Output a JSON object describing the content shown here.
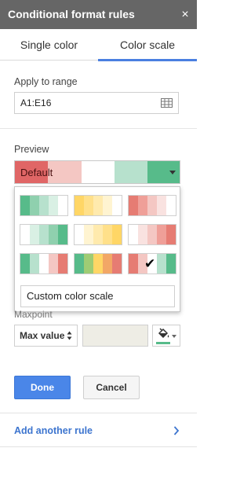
{
  "header": {
    "title": "Conditional format rules",
    "close_glyph": "×"
  },
  "tabs": [
    {
      "label": "Single color",
      "selected": false
    },
    {
      "label": "Color scale",
      "selected": true
    }
  ],
  "range": {
    "label": "Apply to range",
    "value": "A1:E16"
  },
  "preview": {
    "label": "Preview",
    "text": "Default",
    "colors": [
      "#e06666",
      "#f4c7c3",
      "#ffffff",
      "#b7e1cd",
      "#57bb8a"
    ]
  },
  "scales": [
    {
      "selected": false,
      "colors": [
        "#57bb8a",
        "#8fd0ae",
        "#b7e1cd",
        "#d9f0e4",
        "#ffffff"
      ]
    },
    {
      "selected": false,
      "colors": [
        "#ffd666",
        "#ffe08a",
        "#ffeaad",
        "#fff4d1",
        "#ffffff"
      ]
    },
    {
      "selected": false,
      "colors": [
        "#e67c73",
        "#ef9f98",
        "#f4c7c3",
        "#f9e2e0",
        "#ffffff"
      ]
    },
    {
      "selected": false,
      "colors": [
        "#ffffff",
        "#d9f0e4",
        "#b7e1cd",
        "#8fd0ae",
        "#57bb8a"
      ]
    },
    {
      "selected": false,
      "colors": [
        "#ffffff",
        "#fff4d1",
        "#ffeaad",
        "#ffe08a",
        "#ffd666"
      ]
    },
    {
      "selected": false,
      "colors": [
        "#ffffff",
        "#f9e2e0",
        "#f4c7c3",
        "#ef9f98",
        "#e67c73"
      ]
    },
    {
      "selected": false,
      "colors": [
        "#57bb8a",
        "#b7e1cd",
        "#ffffff",
        "#f4c7c3",
        "#e67c73"
      ]
    },
    {
      "selected": false,
      "colors": [
        "#57bb8a",
        "#9fcc74",
        "#ffd666",
        "#f2a766",
        "#e67c73"
      ]
    },
    {
      "selected": true,
      "check": "✔",
      "colors": [
        "#e67c73",
        "#f4c7c3",
        "#ffffff",
        "#b7e1cd",
        "#57bb8a"
      ]
    }
  ],
  "custom_scale_label": "Custom color scale",
  "midpoint": {
    "label": "Maxpoint",
    "select_value": "Max value",
    "color": "#57bb8a"
  },
  "buttons": {
    "done": "Done",
    "cancel": "Cancel"
  },
  "add_rule": "Add another rule",
  "icons": [
    "grid-icon",
    "close-icon",
    "paint-bucket-icon",
    "chevron-right-icon",
    "checkmark-icon"
  ]
}
